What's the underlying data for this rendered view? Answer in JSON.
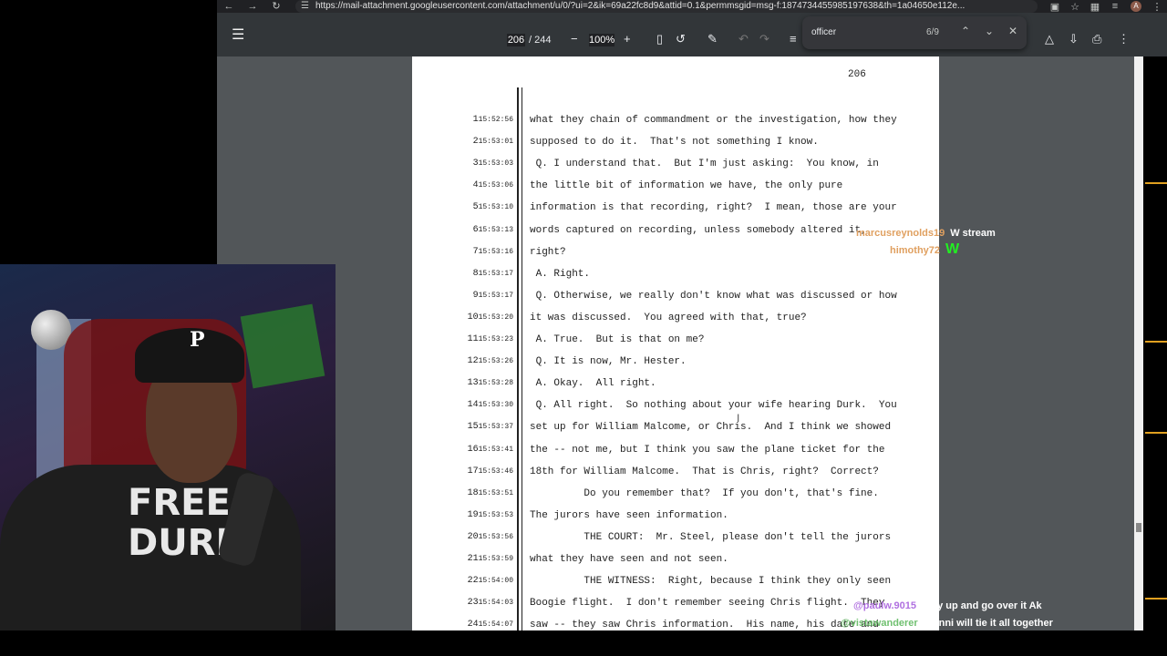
{
  "browser": {
    "url": "https://mail-attachment.googleusercontent.com/attachment/u/0/?ui=2&ik=69a22fc8d9&attid=0.1&permmsgid=msg-f:1874734455985197638&th=1a04650e112e...",
    "avatar_letter": "A"
  },
  "pdf_toolbar": {
    "page_current": "206",
    "page_total": "/ 244",
    "zoom": "100%"
  },
  "find": {
    "query": "officer",
    "count": "6/9"
  },
  "page": {
    "page_number": "206",
    "lines": [
      {
        "n": "1",
        "t": "15:52:56",
        "text": "what they chain of commandment or the investigation, how they"
      },
      {
        "n": "2",
        "t": "15:53:01",
        "text": "supposed to do it.  That's not something I know."
      },
      {
        "n": "3",
        "t": "15:53:03",
        "text": " Q. I understand that.  But I'm just asking:  You know, in"
      },
      {
        "n": "4",
        "t": "15:53:06",
        "text": "the little bit of information we have, the only pure"
      },
      {
        "n": "5",
        "t": "15:53:10",
        "text": "information is that recording, right?  I mean, those are your"
      },
      {
        "n": "6",
        "t": "15:53:13",
        "text": "words captured on recording, unless somebody altered it,"
      },
      {
        "n": "7",
        "t": "15:53:16",
        "text": "right?"
      },
      {
        "n": "8",
        "t": "15:53:17",
        "text": " A. Right."
      },
      {
        "n": "9",
        "t": "15:53:17",
        "text": " Q. Otherwise, we really don't know what was discussed or how"
      },
      {
        "n": "10",
        "t": "15:53:20",
        "text": "it was discussed.  You agreed with that, true?"
      },
      {
        "n": "11",
        "t": "15:53:23",
        "text": " A. True.  But is that on me?"
      },
      {
        "n": "12",
        "t": "15:53:26",
        "text": " Q. It is now, Mr. Hester."
      },
      {
        "n": "13",
        "t": "15:53:28",
        "text": " A. Okay.  All right."
      },
      {
        "n": "14",
        "t": "15:53:30",
        "text": " Q. All right.  So nothing about your wife hearing Durk.  You"
      },
      {
        "n": "15",
        "t": "15:53:37",
        "text": "set up for William Malcome, or Chris.  And I think we showed"
      },
      {
        "n": "16",
        "t": "15:53:41",
        "text": "the -- not me, but I think you saw the plane ticket for the"
      },
      {
        "n": "17",
        "t": "15:53:46",
        "text": "18th for William Malcome.  That is Chris, right?  Correct?"
      },
      {
        "n": "18",
        "t": "15:53:51",
        "text": "         Do you remember that?  If you don't, that's fine."
      },
      {
        "n": "19",
        "t": "15:53:53",
        "text": "The jurors have seen information."
      },
      {
        "n": "20",
        "t": "15:53:56",
        "text": "         THE COURT:  Mr. Steel, please don't tell the jurors"
      },
      {
        "n": "21",
        "t": "15:53:59",
        "text": "what they have seen and not seen."
      },
      {
        "n": "22",
        "t": "15:54:00",
        "text": "         THE WITNESS:  Right, because I think they only seen"
      },
      {
        "n": "23",
        "t": "15:54:03",
        "text": "Boogie flight.  I don't remember seeing Chris flight.  They"
      },
      {
        "n": "24",
        "t": "15:54:07",
        "text": "saw -- they saw Chris information.  His name, his date and"
      }
    ]
  },
  "webcam": {
    "cap_logo": "P",
    "shirt_text_1": "FREE",
    "shirt_text_2": "DURK"
  },
  "chat": [
    {
      "user": "marcusreynolds19",
      "message": "W stream",
      "user_color": "#e0a060"
    },
    {
      "user": "himothy72",
      "message": "W",
      "user_color": "#e0a060"
    },
    {
      "user": "@paulw.9015",
      "message": "Stay up and go over it Ak",
      "user_color": "#b070e0"
    },
    {
      "user": "@vistawanderer",
      "message": "Wonni will tie it all together",
      "user_color": "#70c070"
    }
  ]
}
